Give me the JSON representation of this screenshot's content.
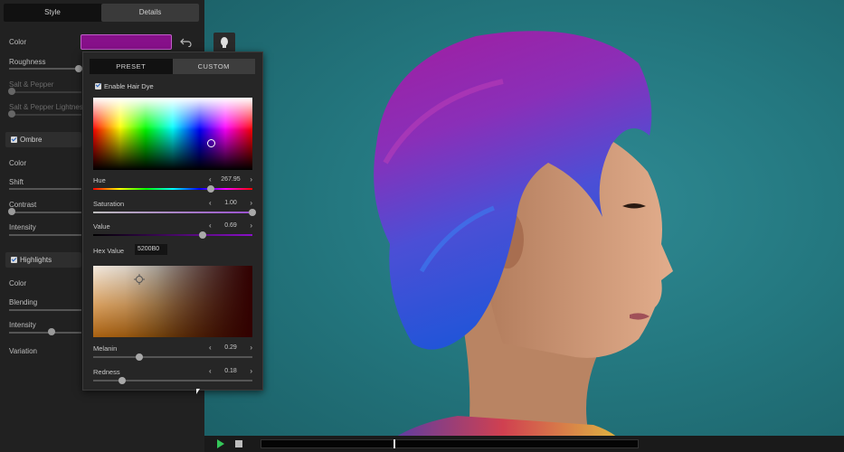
{
  "left_panel": {
    "tabs": [
      {
        "label": "Style"
      },
      {
        "label": "Details"
      }
    ],
    "color_label": "Color",
    "color_value": "#87108a",
    "roughness_label": "Roughness",
    "salt_pepper_label": "Salt & Pepper",
    "salt_pepper_lightness_label": "Salt & Pepper Lightnes",
    "ombre": {
      "label": "Ombre",
      "checked": true,
      "items": [
        "Color",
        "Shift",
        "Contrast",
        "Intensity"
      ]
    },
    "highlights": {
      "label": "Highlights",
      "checked": true,
      "items": [
        "Color",
        "Blending",
        "Intensity",
        "Variation"
      ]
    }
  },
  "popup": {
    "tabs": [
      {
        "label": "PRESET"
      },
      {
        "label": "CUSTOM"
      }
    ],
    "enable_label": "Enable Hair Dye",
    "hue": {
      "label": "Hue",
      "value": "267.95",
      "fraction": 0.74
    },
    "saturation": {
      "label": "Saturation",
      "value": "1.00",
      "fraction": 1.0
    },
    "value": {
      "label": "Value",
      "value": "0.69",
      "fraction": 0.69
    },
    "hex": {
      "label": "Hex Value",
      "value": "5200B0"
    },
    "melanin": {
      "label": "Melanin",
      "value": "0.29",
      "fraction": 0.29
    },
    "redness": {
      "label": "Redness",
      "value": "0.18",
      "fraction": 0.18
    }
  },
  "colors": {
    "accent_purple": "#87108a",
    "play_green": "#34c759"
  },
  "icons": [
    "undo-icon",
    "head-icon",
    "play-icon",
    "stop-icon",
    "checkbox-icon"
  ]
}
